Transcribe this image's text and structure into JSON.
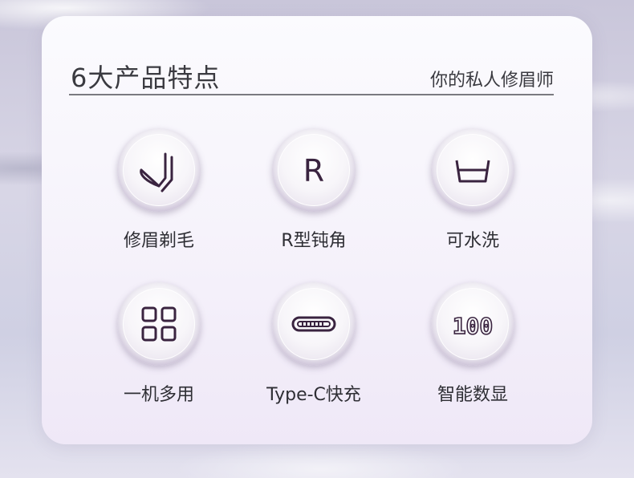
{
  "header": {
    "title": "6大产品特点",
    "subtitle": "你的私人修眉师"
  },
  "features": [
    {
      "label": "修眉剃毛",
      "icon": "trimmer-icon"
    },
    {
      "label": "R型钝角",
      "icon": "r-letter-icon",
      "glyph": "R"
    },
    {
      "label": "可水洗",
      "icon": "water-basin-icon"
    },
    {
      "label": "一机多用",
      "icon": "grid-four-icon"
    },
    {
      "label": "Type-C快充",
      "icon": "usb-c-port-icon"
    },
    {
      "label": "智能数显",
      "icon": "digital-display-icon",
      "glyph": "100"
    }
  ],
  "colors": {
    "icon_stroke": "#3a2440",
    "text": "#2e2e34",
    "divider": "#7a7a80"
  }
}
